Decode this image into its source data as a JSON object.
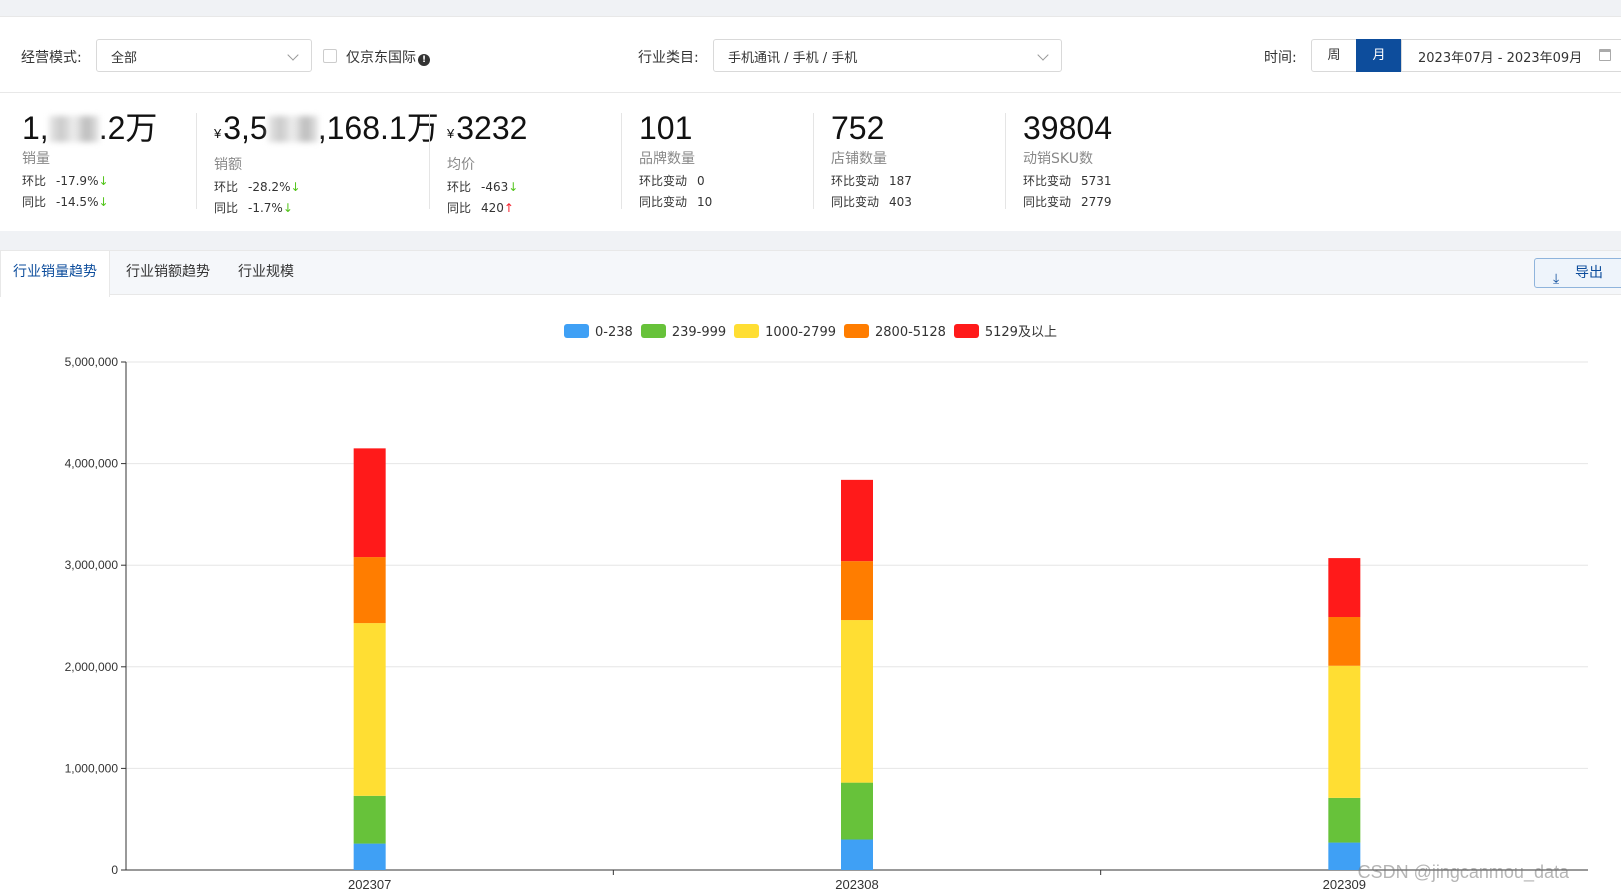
{
  "filters": {
    "mode_label": "经营模式:",
    "mode_value": "全部",
    "jd_intl_label": "仅京东国际",
    "industry_label": "行业类目:",
    "industry_value": "手机通讯 / 手机 / 手机",
    "time_label": "时间:",
    "week_label": "周",
    "month_label": "月",
    "date_range": "2023年07月 - 2023年09月"
  },
  "kpis": [
    {
      "value_prefix": "1,",
      "value_suffix": ".2万",
      "currency": "",
      "label": "销量",
      "line1_label": "环比",
      "line1_value": "-17.9%",
      "line1_dir": "down",
      "line2_label": "同比",
      "line2_value": "-14.5%",
      "line2_dir": "down"
    },
    {
      "value_prefix": "3,5",
      "value_suffix": ",168.1万",
      "currency": "¥",
      "label": "销额",
      "line1_label": "环比",
      "line1_value": "-28.2%",
      "line1_dir": "down",
      "line2_label": "同比",
      "line2_value": "-1.7%",
      "line2_dir": "down"
    },
    {
      "value_prefix": "3232",
      "value_suffix": "",
      "currency": "¥",
      "label": "均价",
      "line1_label": "环比",
      "line1_value": "-463",
      "line1_dir": "down",
      "line2_label": "同比",
      "line2_value": "420",
      "line2_dir": "up"
    },
    {
      "value_prefix": "101",
      "value_suffix": "",
      "currency": "",
      "label": "品牌数量",
      "line1_label": "环比变动",
      "line1_value": "0",
      "line1_dir": "",
      "line2_label": "同比变动",
      "line2_value": "10",
      "line2_dir": ""
    },
    {
      "value_prefix": "752",
      "value_suffix": "",
      "currency": "",
      "label": "店铺数量",
      "line1_label": "环比变动",
      "line1_value": "187",
      "line1_dir": "",
      "line2_label": "同比变动",
      "line2_value": "403",
      "line2_dir": ""
    },
    {
      "value_prefix": "39804",
      "value_suffix": "",
      "currency": "",
      "label": "动销SKU数",
      "line1_label": "环比变动",
      "line1_value": "5731",
      "line1_dir": "",
      "line2_label": "同比变动",
      "line2_value": "2779",
      "line2_dir": ""
    }
  ],
  "tabs": [
    "行业销量趋势",
    "行业销额趋势",
    "行业规模"
  ],
  "export_label": "导出",
  "watermark": "CSDN @jingcanmou_data",
  "chart_data": {
    "type": "bar",
    "stacked": true,
    "categories": [
      "202307",
      "202308",
      "202309"
    ],
    "series": [
      {
        "name": "0-238",
        "color": "#3fa0f5",
        "values": [
          260000,
          300000,
          270000
        ]
      },
      {
        "name": "239-999",
        "color": "#67c23a",
        "values": [
          470000,
          560000,
          440000
        ]
      },
      {
        "name": "1000-2799",
        "color": "#ffde33",
        "values": [
          1700000,
          1600000,
          1300000
        ]
      },
      {
        "name": "2800-5128",
        "color": "#ff7d00",
        "values": [
          650000,
          580000,
          480000
        ]
      },
      {
        "name": "5129及以上",
        "color": "#ff1a1a",
        "values": [
          1070000,
          800000,
          580000
        ]
      }
    ],
    "y_ticks": [
      "0",
      "1,000,000",
      "2,000,000",
      "3,000,000",
      "4,000,000",
      "5,000,000"
    ],
    "ylim": [
      0,
      5000000
    ],
    "grid": true,
    "legend_position": "top-center"
  }
}
